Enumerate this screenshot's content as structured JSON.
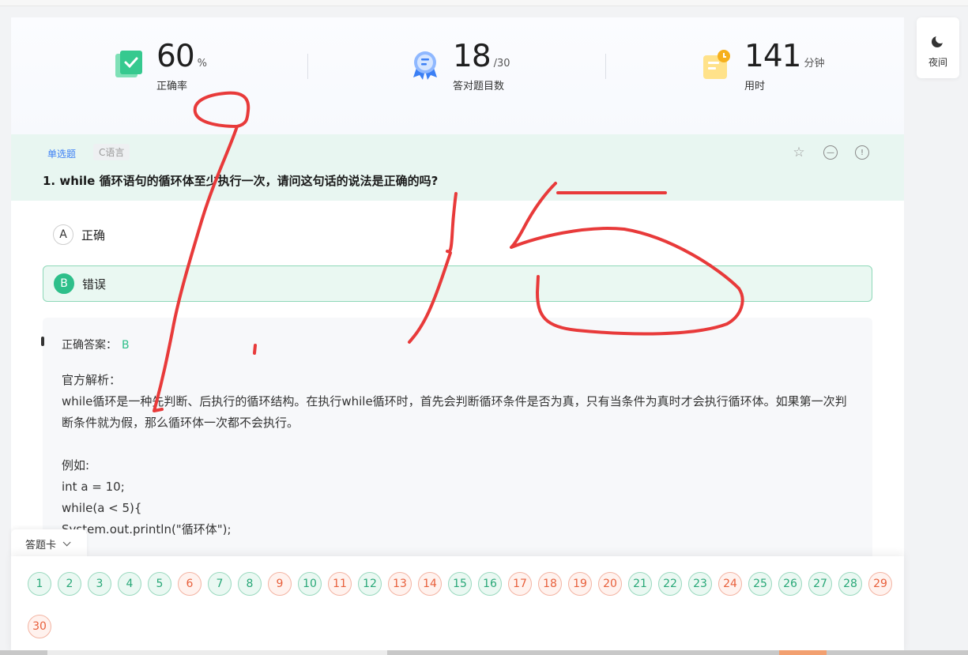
{
  "stats": [
    {
      "value": "60",
      "unit": "%",
      "label": "正确率",
      "icon": "check-book-icon"
    },
    {
      "value": "18",
      "unit": "/30",
      "label": "答对题目数",
      "icon": "award-badge-icon"
    },
    {
      "value": "141",
      "unit": "分钟",
      "label": "用时",
      "icon": "timer-note-icon"
    }
  ],
  "night_mode": {
    "label": "夜间",
    "icon": "moon-icon"
  },
  "question": {
    "type": "单选题",
    "subject": "C语言",
    "title": "1. while 循环语句的循环体至少执行一次，请问这句话的说法是正确的吗?",
    "tools": [
      "star-icon",
      "minus-circle-icon",
      "info-circle-icon"
    ]
  },
  "options": [
    {
      "letter": "A",
      "text": "正确",
      "correct": false
    },
    {
      "letter": "B",
      "text": "错误",
      "correct": true
    }
  ],
  "analysis": {
    "answer_label": "正确答案：",
    "answer_value": "B",
    "explanation": "官方解析：\nwhile循环是一种先判断、后执行的循环结构。在执行while循环时，首先会判断循环条件是否为真，只有当条件为真时才会执行循环体。如果第一次判断条件就为假，那么循环体一次都不会执行。\n\n例如:\nint a = 10;\nwhile(a < 5){\nSystem.out.println(\"循环体\");"
  },
  "answer_sheet": {
    "label": "答题卡",
    "items": [
      {
        "n": "1",
        "status": "ok"
      },
      {
        "n": "2",
        "status": "ok"
      },
      {
        "n": "3",
        "status": "ok"
      },
      {
        "n": "4",
        "status": "ok"
      },
      {
        "n": "5",
        "status": "ok"
      },
      {
        "n": "6",
        "status": "bad"
      },
      {
        "n": "7",
        "status": "ok"
      },
      {
        "n": "8",
        "status": "ok"
      },
      {
        "n": "9",
        "status": "bad"
      },
      {
        "n": "10",
        "status": "ok"
      },
      {
        "n": "11",
        "status": "bad"
      },
      {
        "n": "12",
        "status": "ok"
      },
      {
        "n": "13",
        "status": "bad"
      },
      {
        "n": "14",
        "status": "bad"
      },
      {
        "n": "15",
        "status": "ok"
      },
      {
        "n": "16",
        "status": "ok"
      },
      {
        "n": "17",
        "status": "bad"
      },
      {
        "n": "18",
        "status": "bad"
      },
      {
        "n": "19",
        "status": "bad"
      },
      {
        "n": "20",
        "status": "bad"
      },
      {
        "n": "21",
        "status": "ok"
      },
      {
        "n": "22",
        "status": "ok"
      },
      {
        "n": "23",
        "status": "ok"
      },
      {
        "n": "24",
        "status": "bad"
      },
      {
        "n": "25",
        "status": "ok"
      },
      {
        "n": "26",
        "status": "ok"
      },
      {
        "n": "27",
        "status": "ok"
      },
      {
        "n": "28",
        "status": "ok"
      },
      {
        "n": "29",
        "status": "bad"
      },
      {
        "n": "30",
        "status": "bad"
      }
    ]
  },
  "colors": {
    "correct": "#2ebf8a",
    "wrong": "#e8603c",
    "ink": "#e83a3a",
    "accent": "#3b7ff5"
  }
}
